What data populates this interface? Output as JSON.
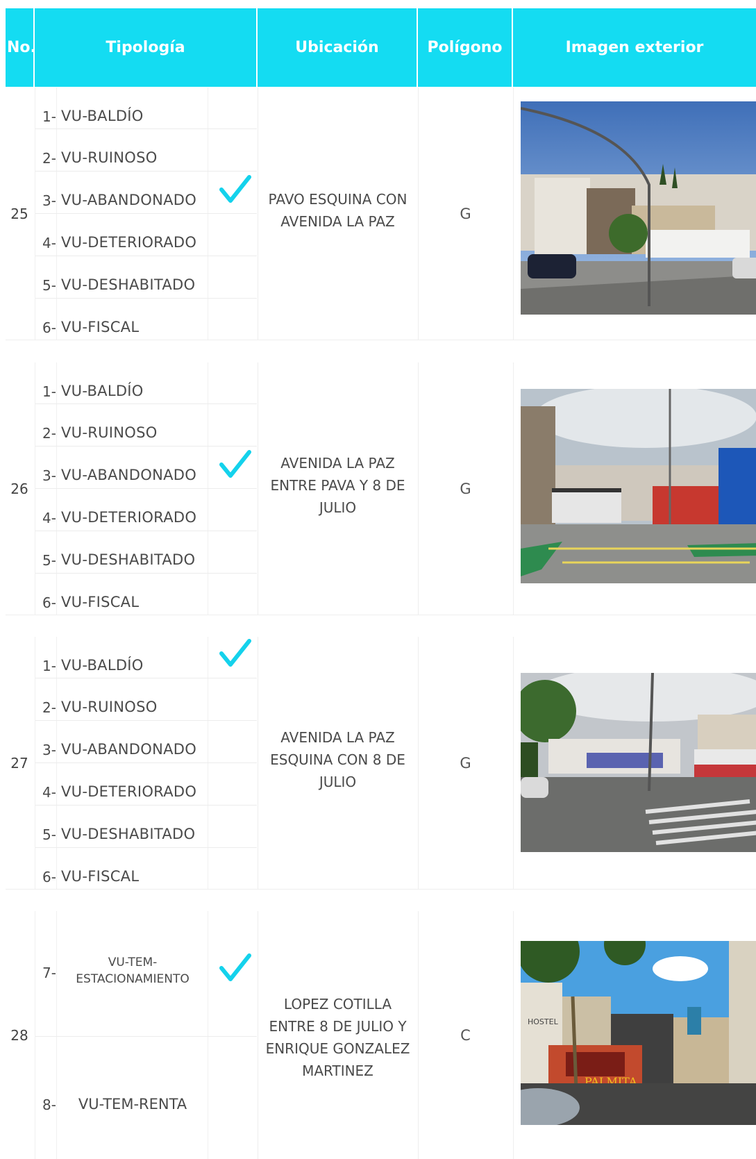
{
  "header": {
    "no": "No.",
    "tipologia": "Tipología",
    "ubicacion": "Ubicación",
    "poligono": "Polígono",
    "imagen": "Imagen exterior"
  },
  "colors": {
    "header_bg": "#14dcf2",
    "check": "#14d2ec"
  },
  "records": [
    {
      "no": "25",
      "tipologias": [
        {
          "num": "1-",
          "label": "VU-BALDÍO"
        },
        {
          "num": "2-",
          "label": "VU-RUINOSO"
        },
        {
          "num": "3-",
          "label": "VU-ABANDONADO"
        },
        {
          "num": "4-",
          "label": "VU-DETERIORADO"
        },
        {
          "num": "5-",
          "label": "VU-DESHABITADO"
        },
        {
          "num": "6-",
          "label": "VU-FISCAL"
        }
      ],
      "checked": "VU-ABANDONADO",
      "ubicacion": "PAVO ESQUINA CON AVENIDA LA PAZ",
      "poligono": "G",
      "image_icon": "street-photo-icon"
    },
    {
      "no": "26",
      "tipologias": [
        {
          "num": "1-",
          "label": "VU-BALDÍO"
        },
        {
          "num": "2-",
          "label": "VU-RUINOSO"
        },
        {
          "num": "3-",
          "label": "VU-ABANDONADO"
        },
        {
          "num": "4-",
          "label": "VU-DETERIORADO"
        },
        {
          "num": "5-",
          "label": "VU-DESHABITADO"
        },
        {
          "num": "6-",
          "label": "VU-FISCAL"
        }
      ],
      "checked": "VU-ABANDONADO",
      "ubicacion": "AVENIDA LA PAZ ENTRE PAVA Y 8 DE JULIO",
      "poligono": "G",
      "image_icon": "street-photo-icon"
    },
    {
      "no": "27",
      "tipologias": [
        {
          "num": "1-",
          "label": "VU-BALDÍO"
        },
        {
          "num": "2-",
          "label": "VU-RUINOSO"
        },
        {
          "num": "3-",
          "label": "VU-ABANDONADO"
        },
        {
          "num": "4-",
          "label": "VU-DETERIORADO"
        },
        {
          "num": "5-",
          "label": "VU-DESHABITADO"
        },
        {
          "num": "6-",
          "label": "VU-FISCAL"
        }
      ],
      "checked": "VU-BALDÍO",
      "ubicacion": "AVENIDA LA PAZ ESQUINA CON 8 DE JULIO",
      "poligono": "G",
      "image_icon": "street-photo-icon"
    },
    {
      "no": "28",
      "tipologias": [
        {
          "num": "7-",
          "label": "VU-TEM-ESTACIONAMIENTO",
          "label_lines": [
            "VU-TEM-",
            "ESTACIONAMIENTO"
          ]
        },
        {
          "num": "8-",
          "label": "VU-TEM-RENTA"
        }
      ],
      "checked": "VU-TEM-ESTACIONAMIENTO",
      "ubicacion": "LOPEZ COTILLA ENTRE 8 DE JULIO Y ENRIQUE GONZALEZ MARTINEZ",
      "poligono": "C",
      "image_icon": "street-photo-icon",
      "sign_text": [
        "HOSTEL",
        "PALMITA"
      ]
    }
  ]
}
